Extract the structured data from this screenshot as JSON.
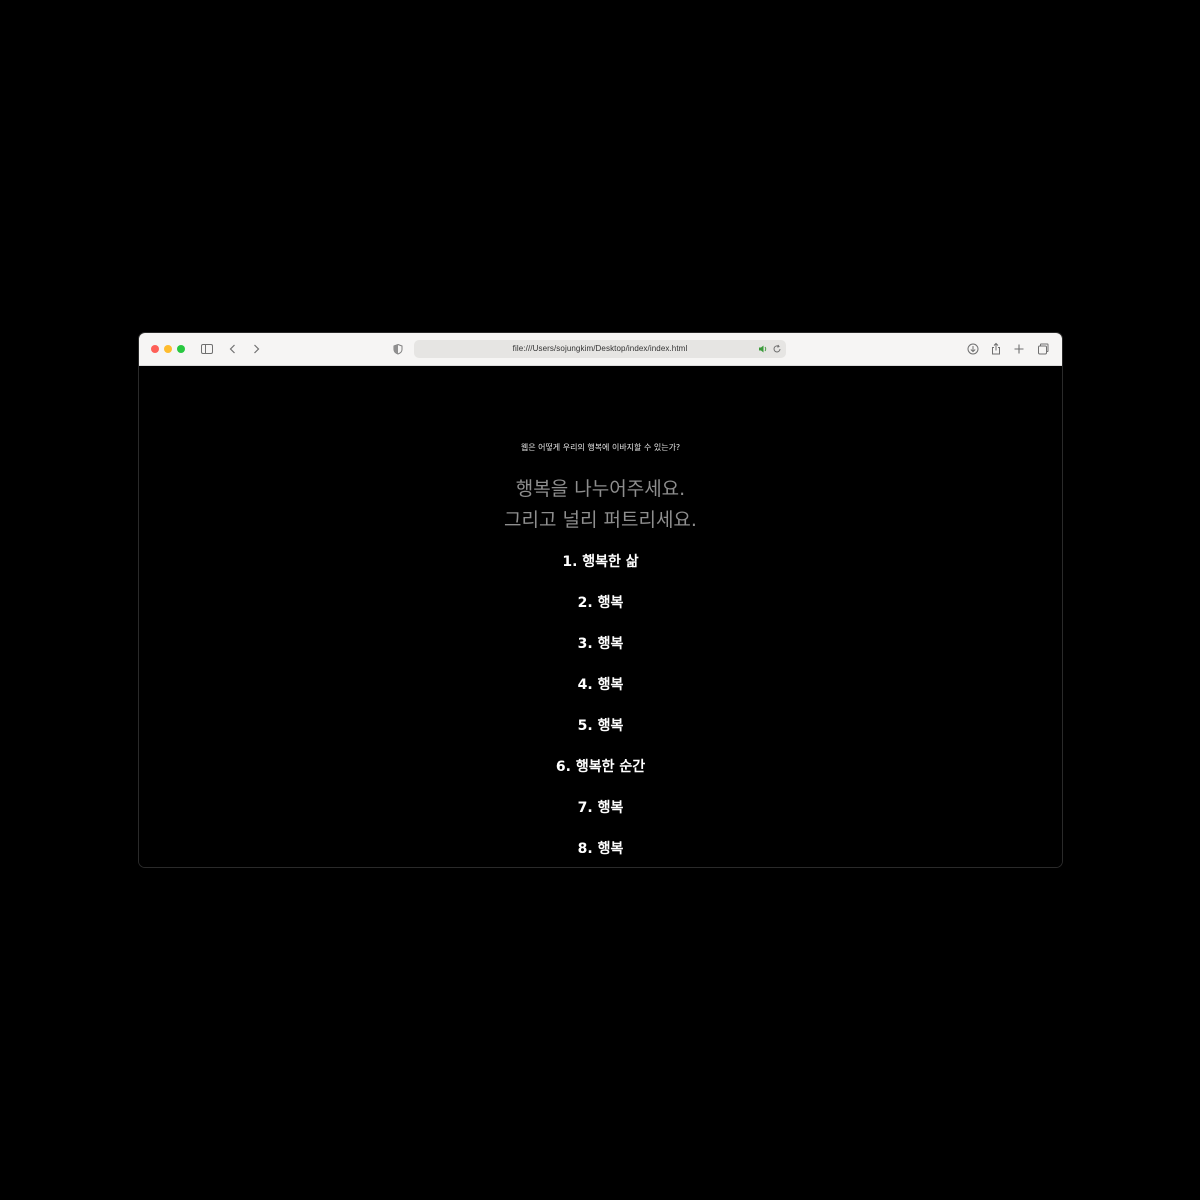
{
  "browser": {
    "url": "file:///Users/sojungkim/Desktop/index/index.html",
    "icons": {
      "sidebar": "sidebar-icon",
      "back": "chevron-left-icon",
      "forward": "chevron-right-icon",
      "shield": "shield-icon",
      "audio": "speaker-icon",
      "reload": "reload-icon",
      "download": "download-icon",
      "share": "share-icon",
      "new_tab": "plus-icon",
      "tabs": "tab-overview-icon"
    }
  },
  "page": {
    "question": "웹은 어떻게 우리의 행복에 이바지할 수 있는가?",
    "headline_line1": "행복을 나누어주세요.",
    "headline_line2": "그리고 널리 퍼트리세요.",
    "items": [
      "1. 행복한 삶",
      "2. 행복",
      "3. 행복",
      "4. 행복",
      "5. 행복",
      "6. 행복한 순간",
      "7. 행복",
      "8. 행복"
    ]
  }
}
